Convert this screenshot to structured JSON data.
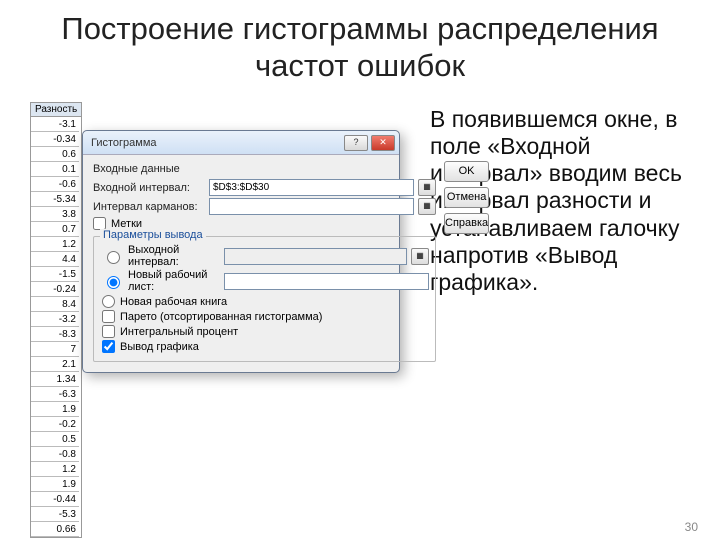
{
  "slide": {
    "title": "Построение гистограммы распределения частот ошибок",
    "body": "В появившемся окне, в поле «Входной интервал» вводим весь интервал разности и устанавливаем галочку напротив «Вывод графика».",
    "page": "30"
  },
  "sheet": {
    "header": "Разность",
    "values": [
      "-3.1",
      "-0.34",
      "0.6",
      "0.1",
      "-0.6",
      "-5.34",
      "3.8",
      "0.7",
      "1.2",
      "4.4",
      "-1.5",
      "-0.24",
      "8.4",
      "-3.2",
      "-8.3",
      "7",
      "2.1",
      "1.34",
      "-6.3",
      "1.9",
      "-0.2",
      "0.5",
      "-0.8",
      "1.2",
      "1.9",
      "-0.44",
      "-5.3",
      "0.66"
    ]
  },
  "dialog": {
    "title": "Гистограмма",
    "buttons": {
      "ok": "OK",
      "cancel": "Отмена",
      "help": "Справка"
    },
    "input_section": "Входные данные",
    "input_range_label": "Входной интервал:",
    "input_range_value": "$D$3:$D$30",
    "bin_range_label": "Интервал карманов:",
    "labels_chk": "Метки",
    "output_section": "Параметры вывода",
    "out_range_label": "Выходной интервал:",
    "new_ws_label": "Новый рабочий лист:",
    "new_wb_label": "Новая рабочая книга",
    "pareto_label": "Парето (отсортированная гистограмма)",
    "cumul_label": "Интегральный процент",
    "chart_label": "Вывод графика"
  }
}
